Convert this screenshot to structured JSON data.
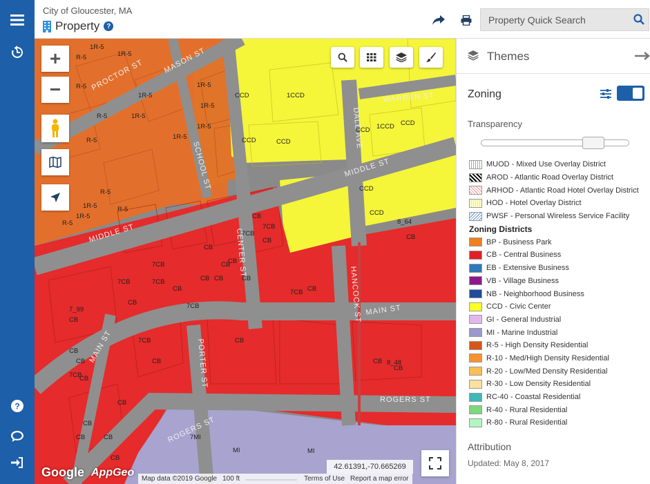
{
  "header": {
    "city": "City of Gloucester, MA",
    "title": "Property",
    "search_placeholder": "Property Quick Search"
  },
  "map": {
    "coordinates": "42.61391,-70.665269",
    "attribution": {
      "map_data": "Map data ©2019 Google",
      "scale": "100 ft",
      "terms": "Terms of Use",
      "report": "Report a map error"
    },
    "logos": {
      "google": "Google",
      "appgeo": "AppGeo"
    },
    "streets": [
      "PROCTOR ST",
      "MASON ST",
      "SCHOOL ST",
      "MIDDLE ST",
      "DALE AVE",
      "WARREN ST",
      "CENTER ST",
      "HANCOCK ST",
      "MAIN ST",
      "PORTER ST",
      "ROGERS ST"
    ],
    "parcel_labels": [
      {
        "t": "R-5"
      },
      {
        "t": "1R-5"
      },
      {
        "t": "R-5"
      },
      {
        "t": "1R-5"
      },
      {
        "t": "1R-5"
      },
      {
        "t": "1R-5"
      },
      {
        "t": "R-5"
      },
      {
        "t": "R-5"
      },
      {
        "t": "1R-5"
      },
      {
        "t": "R-5"
      },
      {
        "t": "R-5"
      },
      {
        "t": "R-5"
      },
      {
        "t": "1R-5"
      },
      {
        "t": "1R-5"
      },
      {
        "t": "1R-5"
      },
      {
        "t": "1R-5"
      },
      {
        "t": "1R-5"
      },
      {
        "t": "R-5"
      },
      {
        "t": "CCD"
      },
      {
        "t": "1CCD"
      },
      {
        "t": "CCD"
      },
      {
        "t": "CCD"
      },
      {
        "t": "CCD"
      },
      {
        "t": "1CCD"
      },
      {
        "t": "CCD"
      },
      {
        "t": "CCD"
      },
      {
        "t": "CCD"
      },
      {
        "t": "8_64"
      },
      {
        "t": "CB"
      },
      {
        "t": "7CB"
      },
      {
        "t": "CB"
      },
      {
        "t": "CB"
      },
      {
        "t": "CB"
      },
      {
        "t": "CB"
      },
      {
        "t": "7CB"
      },
      {
        "t": "7CB"
      },
      {
        "t": "CB"
      },
      {
        "t": "CB"
      },
      {
        "t": "CB"
      },
      {
        "t": "CB"
      },
      {
        "t": "CB"
      },
      {
        "t": "7_99"
      },
      {
        "t": "CB"
      },
      {
        "t": "7CB"
      },
      {
        "t": "7CB"
      },
      {
        "t": "CB"
      },
      {
        "t": "7CB"
      },
      {
        "t": "CB"
      },
      {
        "t": "7CB"
      },
      {
        "t": "7CB"
      },
      {
        "t": "CB"
      },
      {
        "t": "7CB"
      },
      {
        "t": "CB"
      },
      {
        "t": "CB"
      },
      {
        "t": "CB"
      },
      {
        "t": "CB"
      },
      {
        "t": "CB"
      },
      {
        "t": "CB"
      },
      {
        "t": "CB"
      },
      {
        "t": "CB"
      },
      {
        "t": "CB"
      },
      {
        "t": "CB"
      },
      {
        "t": "CB"
      },
      {
        "t": "8_48"
      },
      {
        "t": "7MI"
      },
      {
        "t": "MI"
      },
      {
        "t": "MI"
      }
    ]
  },
  "panel": {
    "title": "Themes",
    "section": "Zoning",
    "transparency_label": "Transparency",
    "transparency": 0.8,
    "overlay_items": [
      {
        "label": "MUOD - Mixed Use Overlay District",
        "pattern": "green-vertical-lines"
      },
      {
        "label": "AROD - Atlantic Road Overlay District",
        "pattern": "black-diagonal-hatch"
      },
      {
        "label": "ARHOD - Atlantic Road Hotel Overlay District",
        "pattern": "red-diagonal-hatch"
      },
      {
        "label": "HOD - Hotel Overlay District",
        "pattern": "light-yellow-lines"
      },
      {
        "label": "PWSF - Personal Wireless Service Facility",
        "pattern": "blue-diagonal-lines"
      }
    ],
    "districts_heading": "Zoning Districts",
    "districts": [
      {
        "label": "BP - Business Park",
        "color": "#f07f1e"
      },
      {
        "label": "CB - Central Business",
        "color": "#e21f26"
      },
      {
        "label": "EB - Extensive Business",
        "color": "#2f78bd"
      },
      {
        "label": "VB - Village Business",
        "color": "#8c1a8c"
      },
      {
        "label": "NB - Neighborhood Business",
        "color": "#1f4c9c"
      },
      {
        "label": "CCD - Civic Center",
        "color": "#ffff26"
      },
      {
        "label": "GI - General Industrial",
        "color": "#e3b7ee"
      },
      {
        "label": "MI - Marine Industrial",
        "color": "#9999cc"
      },
      {
        "label": "R-5 - High Density Residential",
        "color": "#d4571a"
      },
      {
        "label": "R-10 - Med/High Density Residential",
        "color": "#f7922e"
      },
      {
        "label": "R-20 - Low/Med Density Residential",
        "color": "#fbbd56"
      },
      {
        "label": "R-30 - Low Density Residential",
        "color": "#fde09c"
      },
      {
        "label": "RC-40 - Coastal Residential",
        "color": "#3fb8b8"
      },
      {
        "label": "R-40 - Rural Residential",
        "color": "#7dd87d"
      },
      {
        "label": "R-80 - Rural Residential",
        "color": "#b3f5c0"
      }
    ],
    "attribution_title": "Attribution",
    "updated": "Updated: May 8, 2017"
  }
}
